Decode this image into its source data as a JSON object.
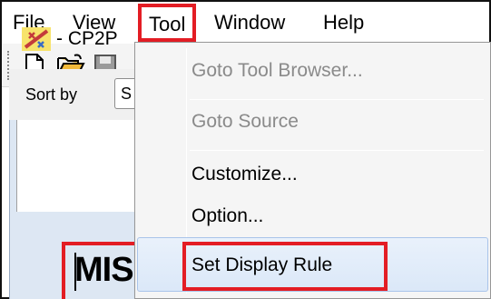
{
  "menubar": {
    "items": [
      {
        "label": "File"
      },
      {
        "label": "View"
      },
      {
        "label": "Tool"
      },
      {
        "label": "Window"
      },
      {
        "label": "Help"
      }
    ]
  },
  "inner_window": {
    "title": "- CP2P",
    "sort_label": "Sort by",
    "sort_value": "S",
    "content_text": "MIS"
  },
  "tool_menu": {
    "items": [
      {
        "label": "Goto Tool Browser...",
        "enabled": false
      },
      {
        "label": "Goto Source",
        "enabled": false
      },
      {
        "label": "Customize...",
        "enabled": true
      },
      {
        "label": "Option...",
        "enabled": true
      },
      {
        "label": "Set Display Rule",
        "enabled": true,
        "highlighted": true
      }
    ]
  },
  "colors": {
    "highlight_box": "#e31d24",
    "menu_background": "#f5f5f5",
    "disabled_text": "#8a8a8a",
    "hover_background": "#dbe8f8"
  },
  "icons": [
    "new-document-icon",
    "open-folder-icon",
    "save-icon",
    "app-icon"
  ]
}
